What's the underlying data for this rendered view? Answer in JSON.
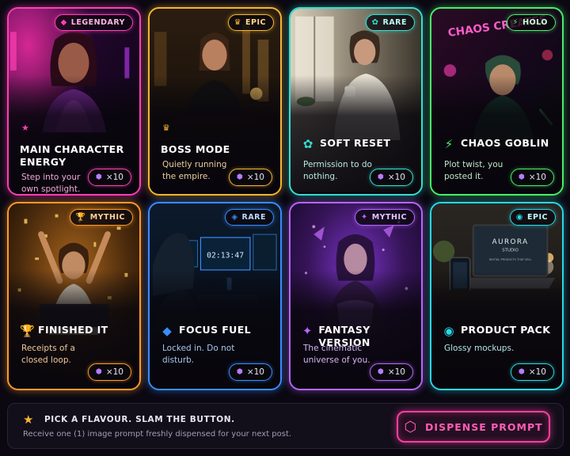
{
  "cards": [
    {
      "badge": "LEGENDARY",
      "badge_icon": "◆",
      "title": "MAIN CHARACTER ENERGY",
      "title_icon": "",
      "small_icon": "★",
      "desc": "Step into your own spotlight.",
      "cost": "×10",
      "class": "c-legendary"
    },
    {
      "badge": "EPIC",
      "badge_icon": "♛",
      "title": "BOSS MODE",
      "title_icon": "",
      "small_icon": "♛",
      "desc": "Quietly running the empire.",
      "cost": "×10",
      "class": "c-epic"
    },
    {
      "badge": "RARE",
      "badge_icon": "✿",
      "title": "SOFT RESET",
      "title_icon": "✿",
      "small_icon": "",
      "desc": "Permission to do nothing.",
      "cost": "×10",
      "class": "c-rare"
    },
    {
      "badge": "HOLO",
      "badge_icon": "⚡",
      "title": "CHAOS GOBLIN",
      "title_icon": "⚡",
      "small_icon": "",
      "desc": "Plot twist, you posted it.",
      "cost": "×10",
      "class": "c-holo"
    },
    {
      "badge": "MYTHIC",
      "badge_icon": "🏆",
      "title": "FINISHED IT",
      "title_icon": "🏆",
      "small_icon": "",
      "desc": "Receipts of a closed loop.",
      "cost": "×10",
      "class": "c-mythic"
    },
    {
      "badge": "RARE",
      "badge_icon": "◈",
      "title": "FOCUS FUEL",
      "title_icon": "◆",
      "small_icon": "",
      "desc": "Locked in. Do not disturb.",
      "cost": "×10",
      "class": "c-rare2"
    },
    {
      "badge": "MYTHIC",
      "badge_icon": "✦",
      "title": "FANTASY VERSION",
      "title_icon": "✦",
      "small_icon": "",
      "desc": "The cinematic universe of you.",
      "cost": "×10",
      "class": "c-mythic2"
    },
    {
      "badge": "EPIC",
      "badge_icon": "◉",
      "title": "PRODUCT PACK",
      "title_icon": "◉",
      "small_icon": "",
      "desc": "Glossy mockups.",
      "cost": "×10",
      "class": "c-epic2"
    }
  ],
  "scene_text": {
    "neon_chaos": "CHAOS CREATES",
    "clock": "02:13:47",
    "aurora": "AURORA",
    "studio": "STUDIO",
    "digital": "DIGITAL PRODUCTS THAT SELL"
  },
  "footer": {
    "title": "PICK A FLAVOUR. SLAM THE BUTTON.",
    "subtitle": "Receive one (1) image prompt freshly dispensed for your next post.",
    "button_label": "DISPENSE PROMPT"
  },
  "icons": {
    "gem": "⬢",
    "star": "★",
    "dispense": "⬡"
  },
  "colors": {
    "legendary": "#ff3fb4",
    "epic": "#f5b531",
    "rare": "#33e0d0",
    "holo": "#48ee6a",
    "mythic": "#ff9a2a",
    "rare_blue": "#3a8cff",
    "mythic_purple": "#b566ff",
    "epic_cyan": "#28d8e6",
    "button": "#ff3fa0"
  }
}
